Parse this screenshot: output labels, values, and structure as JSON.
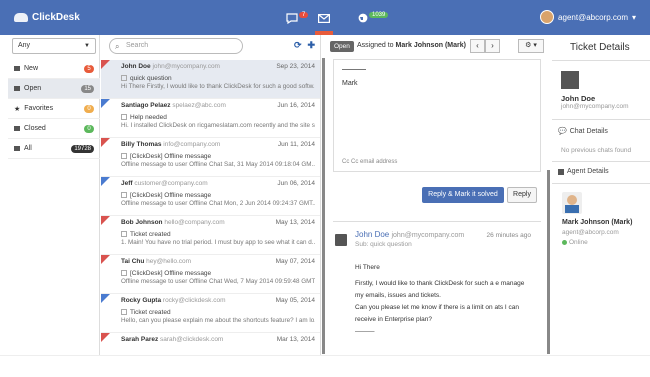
{
  "app": {
    "name": "ClickDesk"
  },
  "topbar": {
    "chat_count": "7",
    "visitors_count": "1039",
    "user_email": "agent@abcorp.com",
    "user_caret": "▾"
  },
  "filter": {
    "selected": "Any"
  },
  "folders": [
    {
      "label": "New",
      "count": "5",
      "color": "#e85b3a"
    },
    {
      "label": "Open",
      "count": "15",
      "color": "#888888"
    },
    {
      "label": "Favorites",
      "count": "0",
      "color": "#f0ad4e"
    },
    {
      "label": "Closed",
      "count": "0",
      "color": "#5cb85c"
    },
    {
      "label": "All",
      "count": "19728",
      "color": "#333333"
    }
  ],
  "search": {
    "placeholder": "Search"
  },
  "tickets": [
    {
      "name": "John Doe",
      "email": "john@mycompany.com",
      "date": "Sep 23, 2014",
      "subject": "quick question",
      "preview": "Hi There Firstly, I would like to thank ClickDesk for such a good softw...",
      "flag": "red"
    },
    {
      "name": "Santiago Pelaez",
      "email": "spelaez@abc.com",
      "date": "Jun 16, 2014",
      "subject": "Help needed",
      "preview": "Hi. I installed ClickDesk on ricgameslatam.com recently and the site s...",
      "flag": "blue"
    },
    {
      "name": "Billy Thomas",
      "email": "info@company.com",
      "date": "Jun 11, 2014",
      "subject": "[ClickDesk] Offline message",
      "preview": "Offline message to user Offline Chat Sat, 31 May 2014 09:18:04 GM...",
      "flag": "red"
    },
    {
      "name": "Jeff",
      "email": "customer@company.com",
      "date": "Jun 06, 2014",
      "subject": "[ClickDesk] Offline message",
      "preview": "Offline message to user Offline Chat Mon, 2 Jun 2014 09:24:37 GMT...",
      "flag": "blue"
    },
    {
      "name": "Bob Johnson",
      "email": "hello@company.com",
      "date": "May 13, 2014",
      "subject": "Ticket created",
      "preview": "1. Main! You have no trial period. I must buy app to see what it can d...",
      "flag": "red"
    },
    {
      "name": "Tai Chu",
      "email": "hey@hello.com",
      "date": "May 07, 2014",
      "subject": "[ClickDesk] Offline message",
      "preview": "Offline message to user Offline Chat Wed, 7 May 2014 09:59:48 GMT...",
      "flag": "red"
    },
    {
      "name": "Rocky Gupta",
      "email": "rocky@clickdesk.com",
      "date": "May 05, 2014",
      "subject": "Ticket created",
      "preview": "Hello, can you please explain me about the shortcuts feature? I am lo...",
      "flag": "blue"
    },
    {
      "name": "Sarah Parez",
      "email": "sarah@clickdesk.com",
      "date": "Mar 13, 2014",
      "subject": "",
      "preview": "",
      "flag": "red"
    }
  ],
  "detail": {
    "status": "Open",
    "assigned_prefix": "Assigned to",
    "assigned_name": "Mark Johnson (Mark)",
    "prev_label": "‹",
    "next_label": "›",
    "gear_label": "⚙ ▾",
    "editor_signature": "Mark",
    "cc_placeholder": "Cc  Cc email address",
    "reply_mark_label": "Reply & Mark it solved",
    "reply_label": "Reply",
    "message": {
      "from_name": "John Doe",
      "from_email": "john@mycompany.com",
      "time_ago": "26 minutes ago",
      "subject": "Sub: quick question",
      "line1": "Hi There",
      "line2": "Firstly, I would like to thank ClickDesk for such a e manage",
      "line3": "my emails, issues and tickets.",
      "line4": "Can you please let me know if there is a limit on ats I can",
      "line5": "receive in Enterprise plan?",
      "line6": "———"
    }
  },
  "right": {
    "title": "Ticket Details",
    "contact_name": "John Doe",
    "contact_email": "john@mycompany.com",
    "chat_details_label": "Chat Details",
    "no_chats": "No previous chats found",
    "agent_details_label": "Agent Details",
    "agent_name": "Mark Johnson (Mark)",
    "agent_email": "agent@abcorp.com",
    "agent_status": "Online"
  }
}
